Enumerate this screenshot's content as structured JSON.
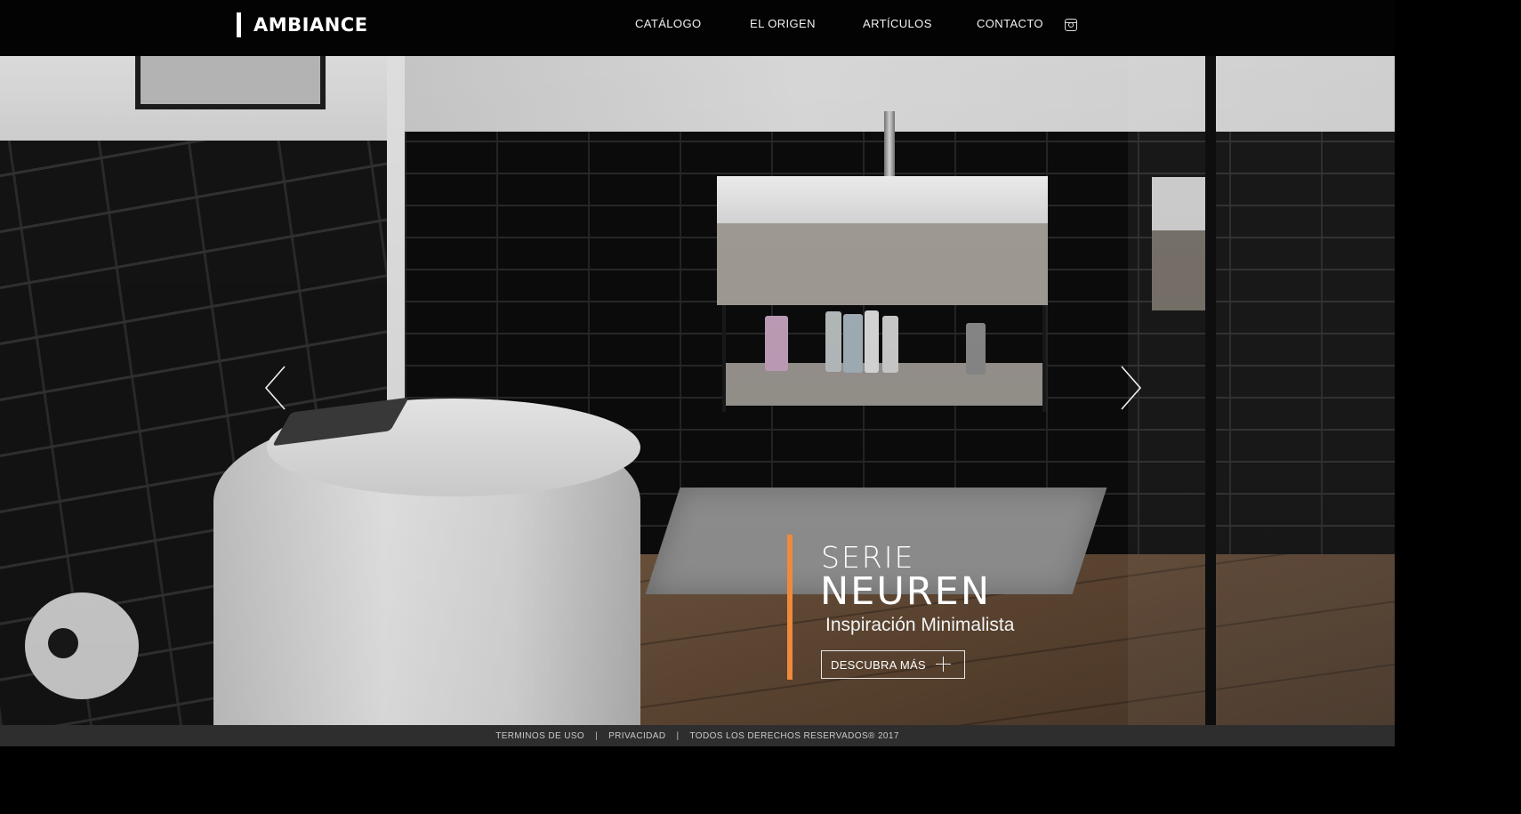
{
  "brand": {
    "logo_text": "AMBIANCE"
  },
  "nav": {
    "items": [
      {
        "label": "CATÁLOGO"
      },
      {
        "label": "EL ORIGEN"
      },
      {
        "label": "ARTÍCULOS"
      },
      {
        "label": "CONTACTO"
      }
    ],
    "social_icon": "instagram-icon"
  },
  "hero": {
    "caption": {
      "line1": "SERIE",
      "line2": "NEUREN",
      "subtitle": "Inspiración Minimalista",
      "cta_label": "DESCUBRA MÁS",
      "accent_color": "#ef8a3c"
    },
    "prev_icon": "chevron-left-icon",
    "next_icon": "chevron-right-icon"
  },
  "footer": {
    "terms": "TERMINOS DE USO",
    "privacy": "PRIVACIDAD",
    "rights": "TODOS LOS DERECHOS RESERVADOS® 2017",
    "separator": "|"
  }
}
